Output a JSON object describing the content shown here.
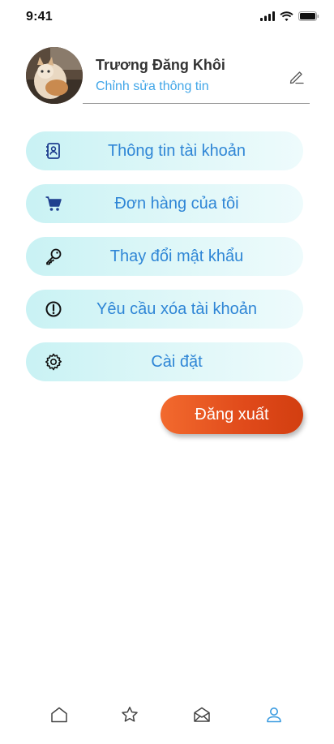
{
  "status_bar": {
    "time": "9:41",
    "icons": [
      "cellular-signal-icon",
      "wifi-icon",
      "battery-icon"
    ]
  },
  "profile": {
    "name": "Trương Đăng Khôi",
    "edit_link": "Chỉnh sửa thông tin",
    "edit_icon": "pencil-icon"
  },
  "menu": {
    "items": [
      {
        "label": "Thông tin tài khoản",
        "icon": "contact-book-icon"
      },
      {
        "label": "Đơn hàng của tôi",
        "icon": "shopping-cart-icon"
      },
      {
        "label": "Thay đổi mật khẩu",
        "icon": "key-icon"
      },
      {
        "label": "Yêu cầu xóa tài khoản",
        "icon": "alert-circle-icon"
      },
      {
        "label": "Cài đặt",
        "icon": "gear-icon"
      }
    ]
  },
  "logout": {
    "label": "Đăng xuất"
  },
  "bottom_nav": {
    "items": [
      {
        "icon": "home-icon",
        "active": false
      },
      {
        "icon": "star-icon",
        "active": false
      },
      {
        "icon": "mail-icon",
        "active": false
      },
      {
        "icon": "user-icon",
        "active": true
      }
    ]
  },
  "colors": {
    "menu_text": "#2f86d6",
    "menu_bg": "#d3f4f6",
    "logout_bg": "#e0501e",
    "link": "#41a6e8",
    "nav_active": "#3a9be0",
    "nav_inactive": "#444444"
  }
}
